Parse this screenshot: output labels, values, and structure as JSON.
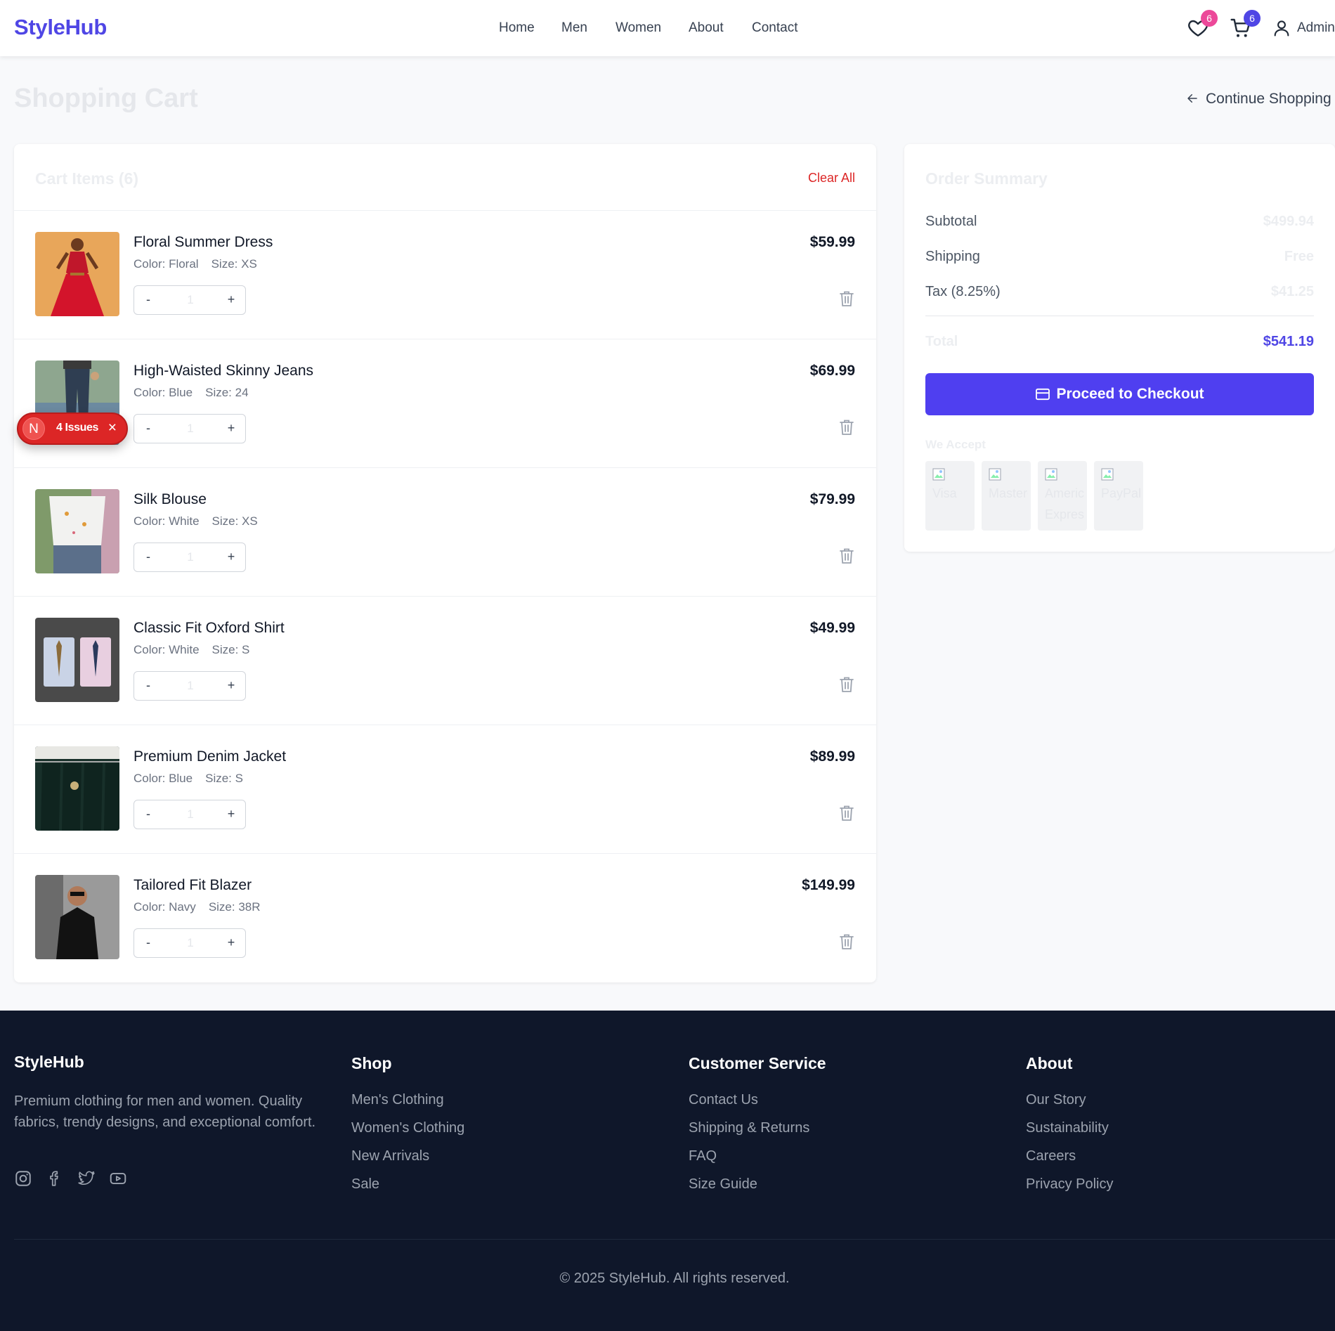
{
  "header": {
    "logo": "StyleHub",
    "nav": [
      "Home",
      "Men",
      "Women",
      "About",
      "Contact"
    ],
    "wishlist_count": "6",
    "cart_count": "6",
    "user_label": "Admin",
    "colors": {
      "brand": "#4f46e5",
      "wishlist_badge": "#ec4899",
      "cart_badge": "#4f46e5"
    }
  },
  "page": {
    "title": "Shopping Cart",
    "continue_label": "Continue Shopping"
  },
  "cart": {
    "heading": "Cart Items (6)",
    "clear_all": "Clear All",
    "items": [
      {
        "name": "Floral Summer Dress",
        "color": "Color: Floral",
        "size": "Size: XS",
        "qty": "1",
        "price": "$59.99",
        "image_icon": "dress-photo"
      },
      {
        "name": "High-Waisted Skinny Jeans",
        "color": "Color: Blue",
        "size": "Size: 24",
        "qty": "1",
        "price": "$69.99",
        "image_icon": "jeans-photo"
      },
      {
        "name": "Silk Blouse",
        "color": "Color: White",
        "size": "Size: XS",
        "qty": "1",
        "price": "$79.99",
        "image_icon": "blouse-photo"
      },
      {
        "name": "Classic Fit Oxford Shirt",
        "color": "Color: White",
        "size": "Size: S",
        "qty": "1",
        "price": "$49.99",
        "image_icon": "shirts-photo"
      },
      {
        "name": "Premium Denim Jacket",
        "color": "Color: Blue",
        "size": "Size: S",
        "qty": "1",
        "price": "$89.99",
        "image_icon": "jackets-photo"
      },
      {
        "name": "Tailored Fit Blazer",
        "color": "Color: Navy",
        "size": "Size: 38R",
        "qty": "1",
        "price": "$149.99",
        "image_icon": "blazer-photo"
      }
    ],
    "minus": "-",
    "plus": "+"
  },
  "issues": {
    "letter": "N",
    "label": "4 Issues",
    "close": "×"
  },
  "summary": {
    "title": "Order Summary",
    "subtotal_label": "Subtotal",
    "subtotal": "$499.94",
    "shipping_label": "Shipping",
    "shipping": "Free",
    "tax_label": "Tax (8.25%)",
    "tax": "$41.25",
    "total_label": "Total",
    "total": "$541.19",
    "checkout": "Proceed to Checkout",
    "accept_label": "We Accept",
    "payments": [
      "Visa",
      "Mastercard",
      "American Express",
      "PayPal"
    ]
  },
  "footer": {
    "brand": "StyleHub",
    "description": "Premium clothing for men and women. Quality fabrics, trendy designs, and exceptional comfort.",
    "social": [
      "instagram-icon",
      "facebook-icon",
      "twitter-icon",
      "youtube-icon"
    ],
    "shop": {
      "title": "Shop",
      "links": [
        "Men's Clothing",
        "Women's Clothing",
        "New Arrivals",
        "Sale"
      ]
    },
    "service": {
      "title": "Customer Service",
      "links": [
        "Contact Us",
        "Shipping & Returns",
        "FAQ",
        "Size Guide"
      ]
    },
    "about": {
      "title": "About",
      "links": [
        "Our Story",
        "Sustainability",
        "Careers",
        "Privacy Policy"
      ]
    },
    "copyright": "© 2025 StyleHub. All rights reserved."
  }
}
